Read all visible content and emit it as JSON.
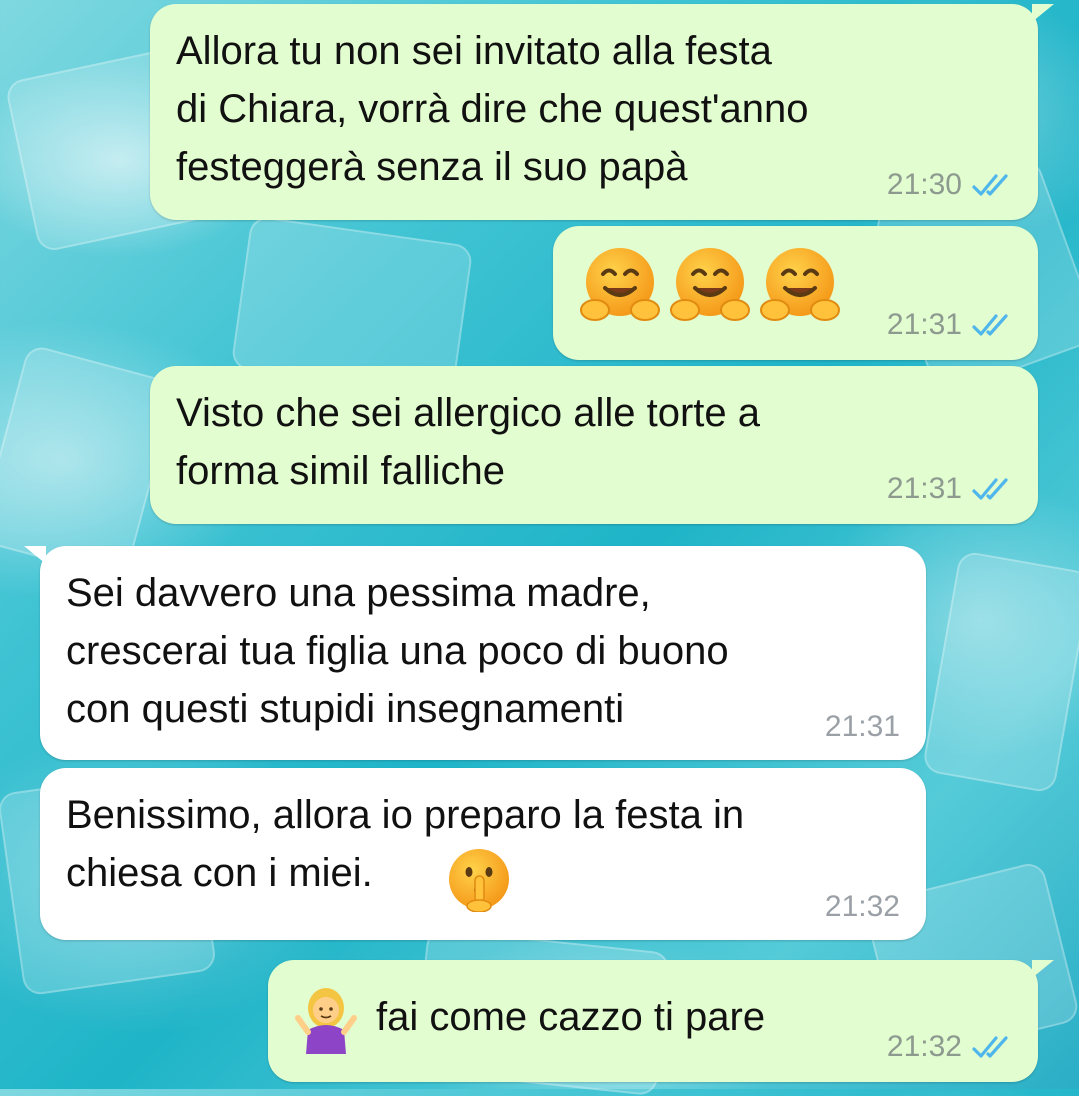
{
  "chat": {
    "messages": [
      {
        "direction": "outgoing",
        "text": "Allora tu non sei invitato alla festa\ndi Chiara, vorrà dire che quest'anno\nfesteggerà senza il suo papà",
        "time": "21:30",
        "status": "read"
      },
      {
        "direction": "outgoing",
        "emojis": [
          "hugging-face-emoji",
          "hugging-face-emoji",
          "hugging-face-emoji"
        ],
        "time": "21:31",
        "status": "read"
      },
      {
        "direction": "outgoing",
        "text": "Visto che sei allergico alle torte a\nforma simil falliche",
        "time": "21:31",
        "status": "read"
      },
      {
        "direction": "incoming",
        "text": "Sei davvero una pessima madre,\ncrescerai tua figlia una poco di buono\ncon questi stupidi insegnamenti",
        "time": "21:31"
      },
      {
        "direction": "incoming",
        "text": "Benissimo, allora io preparo la festa in\nchiesa con i miei.",
        "emoji": "shushing-face-emoji",
        "time": "21:32"
      },
      {
        "direction": "outgoing",
        "emoji": "woman-shrugging-emoji",
        "text": "fai come cazzo ti pare",
        "time": "21:32",
        "status": "read"
      }
    ]
  },
  "colors": {
    "outgoing_bubble": "#e2fdcf",
    "incoming_bubble": "#ffffff",
    "read_ticks": "#4fb6ec",
    "background": "#3fc3d3"
  }
}
